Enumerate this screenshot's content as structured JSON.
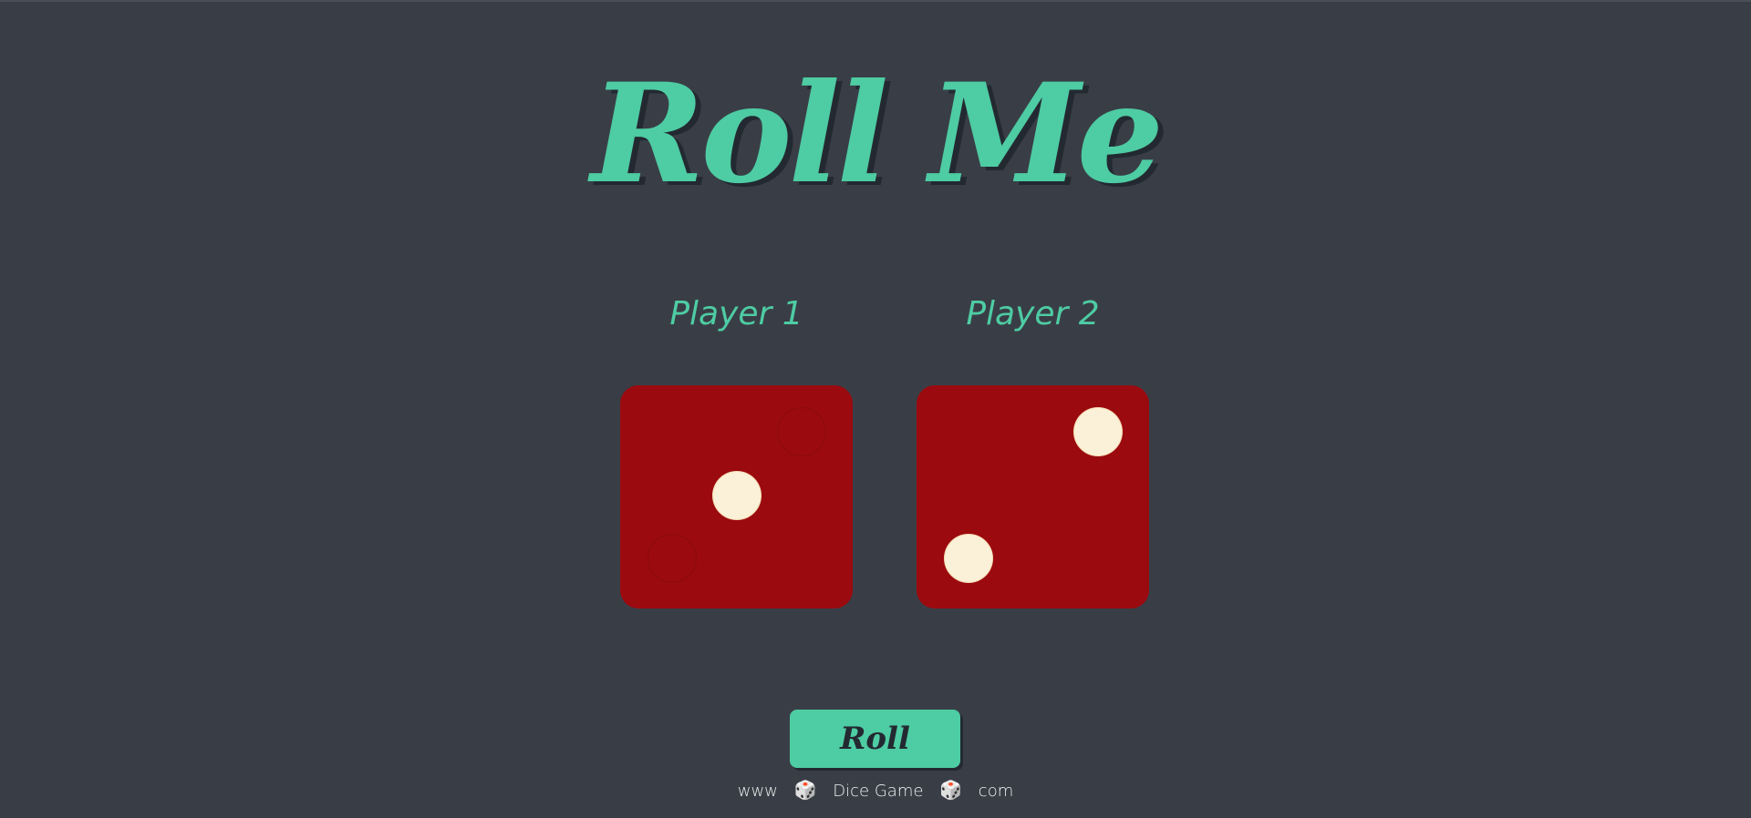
{
  "header": {
    "title": "Roll Me"
  },
  "players": [
    {
      "label": "Player 1",
      "die_value": 1
    },
    {
      "label": "Player 2",
      "die_value": 2
    }
  ],
  "controls": {
    "roll_label": "Roll"
  },
  "footer": {
    "part1": "www",
    "part2": "Dice Game",
    "part3": "com",
    "icon": "🎲"
  },
  "colors": {
    "background": "#393e46",
    "accent": "#4ecca3",
    "die": "#9b0a0f",
    "pip": "#fbf0d8"
  }
}
